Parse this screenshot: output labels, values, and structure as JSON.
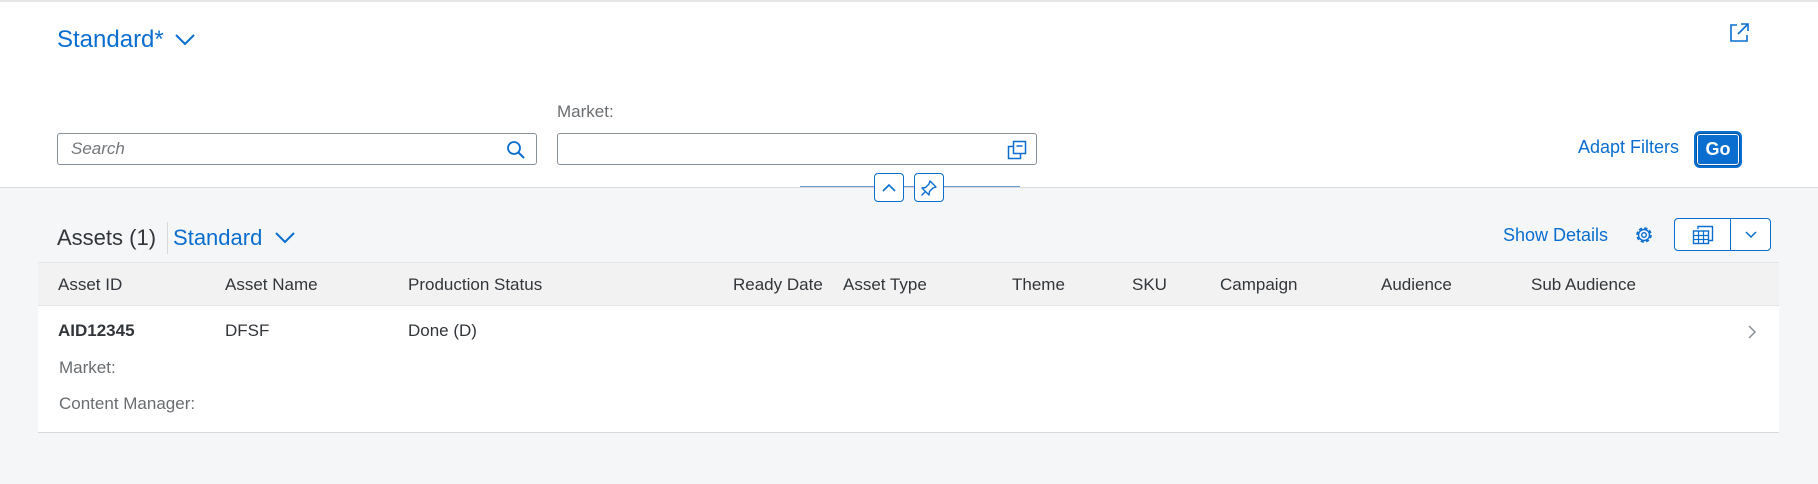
{
  "header": {
    "variant_label": "Standard*",
    "filters": {
      "search_placeholder": "Search",
      "search_value": "",
      "market_label": "Market:",
      "market_value": ""
    },
    "adapt_filters_label": "Adapt Filters",
    "go_label": "Go"
  },
  "table": {
    "title": "Assets (1)",
    "variant_label": "Standard",
    "show_details_label": "Show Details",
    "columns": [
      "Asset ID",
      "Asset Name",
      "Production Status",
      "Ready Date",
      "Asset Type",
      "Theme",
      "SKU",
      "Campaign",
      "Audience",
      "Sub Audience"
    ],
    "rows": [
      {
        "asset_id": "AID12345",
        "asset_name": "DFSF",
        "production_status": "Done (D)",
        "ready_date": "",
        "asset_type": "",
        "theme": "",
        "sku": "",
        "campaign": "",
        "audience": "",
        "sub_audience": "",
        "pop_in": [
          {
            "label": "Market:",
            "value": ""
          },
          {
            "label": "Content Manager:",
            "value": ""
          }
        ]
      }
    ]
  },
  "icons": {
    "variant_dropdown": "chevron-down-icon",
    "share": "share-icon",
    "search": "search-icon",
    "value_help": "value-help-icon",
    "collapse": "chevron-up-icon",
    "pin": "pin-icon",
    "settings": "gear-icon",
    "export": "spreadsheet-export-icon",
    "export_menu": "chevron-down-icon",
    "row_navigation": "chevron-right-icon"
  },
  "colors": {
    "accent": "#0a6ed1",
    "page_background": "#f5f6f7",
    "header_background": "#ffffff",
    "table_header_background": "#f2f2f2"
  }
}
